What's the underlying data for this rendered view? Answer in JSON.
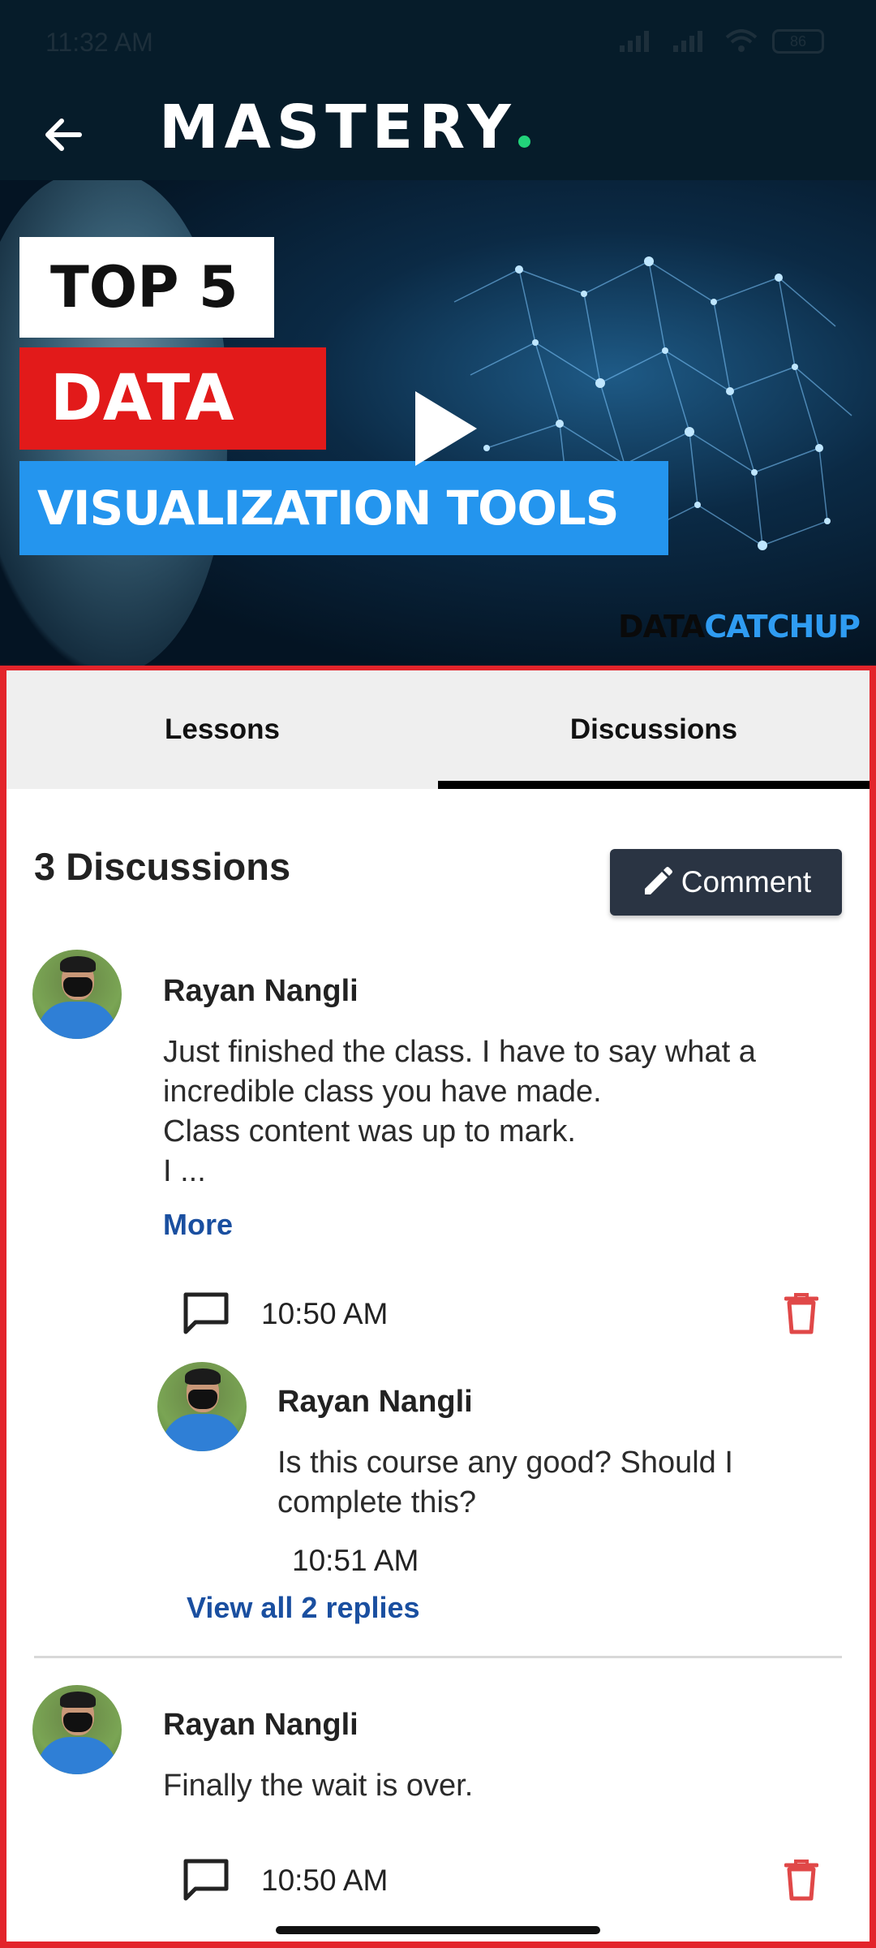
{
  "status_bar": {
    "time": "11:32 AM",
    "battery": "86"
  },
  "app_bar": {
    "brand": "MASTERY"
  },
  "video": {
    "line1": "TOP 5",
    "line2": "DATA",
    "line3": "VISUALIZATION TOOLS",
    "watermark_a": "DATA",
    "watermark_b": "CATCHUP"
  },
  "tabs": [
    {
      "label": "Lessons",
      "active": false
    },
    {
      "label": "Discussions",
      "active": true
    }
  ],
  "discussions": {
    "count_label": "3 Discussions",
    "comment_button": "Comment",
    "items": [
      {
        "author": "Rayan Nangli",
        "text": "Just finished the class. I have to say what a\nincredible class you have made.\nClass content was up to mark.\nI ...",
        "more_label": "More",
        "time": "10:50 AM",
        "reply": {
          "author": "Rayan Nangli",
          "text": "Is this course any good? Should I\ncomplete this?",
          "time": "10:51 AM"
        },
        "view_replies_label": "View all 2 replies"
      },
      {
        "author": "Rayan Nangli",
        "text": "Finally the wait is over.",
        "time": "10:50 AM"
      }
    ]
  },
  "colors": {
    "app_bar_bg": "#061c2a",
    "accent_green": "#22d37a",
    "panel_border": "#e3242b",
    "comment_button_bg": "#2a3443",
    "link_blue": "#1a4fa0",
    "delete_red": "#e04848"
  }
}
